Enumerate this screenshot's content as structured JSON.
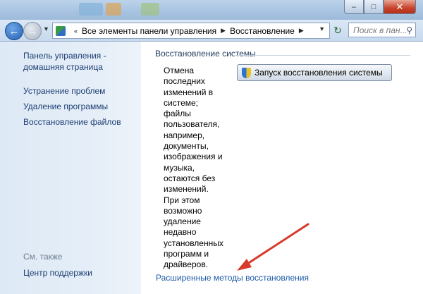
{
  "window": {
    "caption_buttons": {
      "minimize": "–",
      "maximize": "□",
      "close": "✕"
    }
  },
  "navbar": {
    "breadcrumb": [
      "Все элементы панели управления",
      "Восстановление"
    ],
    "search_placeholder": "Поиск в пан...",
    "icons": [
      "back-arrow-icon",
      "forward-arrow-icon",
      "control-panel-icon",
      "refresh-icon",
      "search-icon"
    ]
  },
  "sidebar": {
    "home": "Панель управления -\nдомашняя страница",
    "links": [
      "Устранение проблем",
      "Удаление программы",
      "Восстановление файлов"
    ],
    "see_also_label": "См. также",
    "see_also_link": "Центр поддержки"
  },
  "main": {
    "section_title": "Восстановление системы",
    "description": "Отмена\nпоследних\nизменений в\nсистеме;\nфайлы\nпользователя,\nнапример,\nдокументы,\nизображения и\nмузыка,\nостаются без\nизменений.\nПри этом\nвозможно\nудаление\nнедавно\nустановленных\nпрограмм и\nдрайверов.",
    "launch_button": "Запуск восстановления системы",
    "advanced_link": "Расширенные методы восстановления"
  },
  "colors": {
    "annotation_arrow": "#d63a2a",
    "link": "#1d5aa8",
    "sidebar_bg": "#e3edf7"
  }
}
